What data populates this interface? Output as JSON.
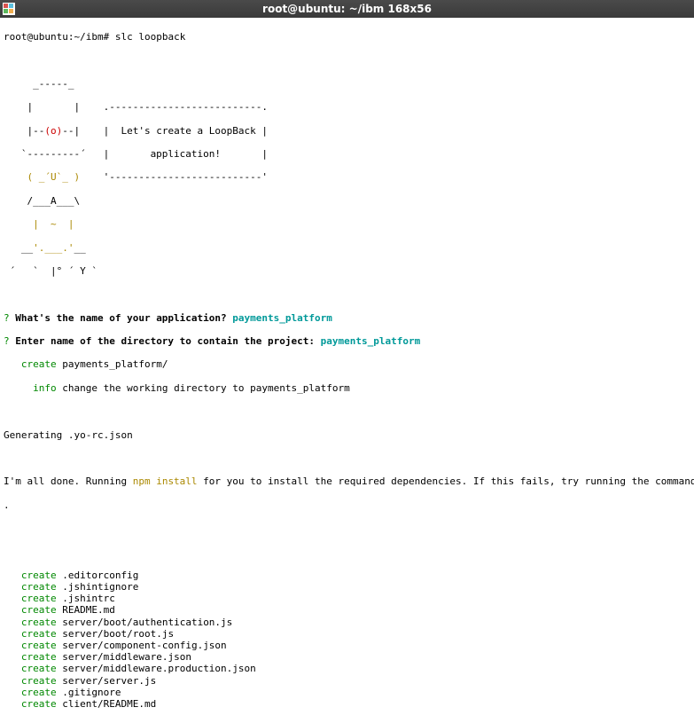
{
  "window": {
    "title": "root@ubuntu: ~/ibm 168x56"
  },
  "prompt": {
    "userhost": "root@ubuntu:~/ibm#",
    "command": "slc loopback"
  },
  "ascii": {
    "l0": "     _-----_",
    "l1a": "    |       |    ",
    "l1b": ".--------------------------.",
    "l2a": "    |--",
    "l2o": "(o)",
    "l2c": "--|    |  Let's create a LoopBack |",
    "l3": "   `---------´   |       application!       |",
    "l4a": "    ",
    "l4p": "( ",
    "l4u": "_",
    "l4q": "´U`",
    "l4r": "_",
    "l4s": " )",
    "l4t": "    '--------------------------'",
    "l5": "    /___A___\\",
    "l6a": "     ",
    "l6b": "|  ~  |",
    "l7a": "   __",
    "l7b": "'.___.'",
    "l7c": "__",
    "l8": " ´   `  |° ´ Y `"
  },
  "qa": {
    "q1_mark": "?",
    "q1_text": " What's the name of your application? ",
    "q1_ans": "payments_platform",
    "q2_mark": "?",
    "q2_text": " Enter name of the directory to contain the project: ",
    "q2_ans": "payments_platform"
  },
  "steps": {
    "create": "create",
    "info": "info",
    "dir": " payments_platform/",
    "info_msg": " change the working directory to payments_platform"
  },
  "gen": {
    "yo": "Generating .yo-rc.json",
    "done_a": "I'm all done. Running ",
    "done_npm": "npm install",
    "done_b": " for you to install the required dependencies. If this fails, try running the command yourself",
    "done_c": "."
  },
  "files": [
    ".editorconfig",
    ".jshintignore",
    ".jshintrc",
    "README.md",
    "server/boot/authentication.js",
    "server/boot/root.js",
    "server/component-config.json",
    "server/middleware.json",
    "server/middleware.production.json",
    "server/server.js",
    ".gitignore",
    "client/README.md"
  ]
}
